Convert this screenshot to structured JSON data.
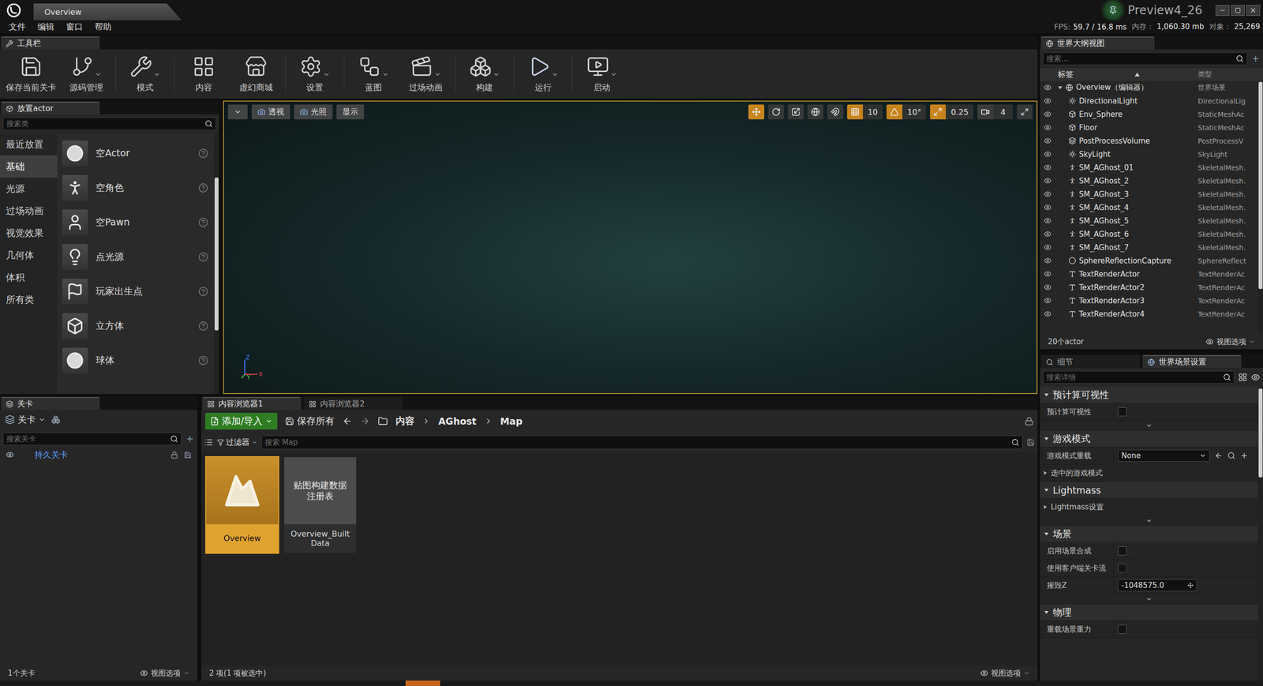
{
  "window": {
    "title": "Overview",
    "project": "Preview4_26"
  },
  "menu": [
    {
      "label": "文件"
    },
    {
      "label": "编辑"
    },
    {
      "label": "窗口"
    },
    {
      "label": "帮助"
    }
  ],
  "stats": [
    {
      "label": "FPS:",
      "value": "59.7 / 16.8 ms"
    },
    {
      "label": "内存：",
      "value": "1,060.30 mb"
    },
    {
      "label": "对象：",
      "value": "25,269"
    }
  ],
  "toolbar": {
    "title": "工具栏",
    "buttons": [
      {
        "label": "保存当前关卡",
        "dropdown": false
      },
      {
        "label": "源码管理",
        "dropdown": true
      },
      {
        "label": "模式",
        "dropdown": true
      },
      {
        "label": "内容",
        "dropdown": false
      },
      {
        "label": "虚幻商城",
        "dropdown": false
      },
      {
        "label": "设置",
        "dropdown": true
      },
      {
        "label": "蓝图",
        "dropdown": true
      },
      {
        "label": "过场动画",
        "dropdown": true
      },
      {
        "label": "构建",
        "dropdown": true
      },
      {
        "label": "运行",
        "dropdown": true
      },
      {
        "label": "启动",
        "dropdown": true
      }
    ]
  },
  "place_actor": {
    "title": "放置actor",
    "search": {
      "placeholder": "搜索类"
    },
    "categories": [
      {
        "label": "最近放置",
        "selected": false
      },
      {
        "label": "基础",
        "selected": true
      },
      {
        "label": "光源",
        "selected": false
      },
      {
        "label": "过场动画",
        "selected": false
      },
      {
        "label": "视觉效果",
        "selected": false
      },
      {
        "label": "几何体",
        "selected": false
      },
      {
        "label": "体积",
        "selected": false
      },
      {
        "label": "所有类",
        "selected": false
      }
    ],
    "items": [
      {
        "label": "空Actor"
      },
      {
        "label": "空角色"
      },
      {
        "label": "空Pawn"
      },
      {
        "label": "点光源"
      },
      {
        "label": "玩家出生点"
      },
      {
        "label": "立方体"
      },
      {
        "label": "球体"
      }
    ]
  },
  "viewport": {
    "view_buttons": [
      {
        "label": "透视"
      },
      {
        "label": "光照"
      },
      {
        "label": "显示"
      }
    ],
    "transform_tools": [
      {
        "selected": true
      },
      {
        "selected": false
      },
      {
        "selected": false
      }
    ],
    "snaps": [
      {
        "value": "10",
        "on": true
      },
      {
        "value": "10°",
        "on": true
      },
      {
        "value": "0.25",
        "on": true
      },
      {
        "value": "4",
        "on": false
      }
    ],
    "axes": [
      "Z",
      "Y",
      "X"
    ]
  },
  "levels": {
    "title": "关卡",
    "menu": "关卡",
    "search": {
      "placeholder": "搜索关卡"
    },
    "items": [
      {
        "label": "持久关卡",
        "visible": true
      }
    ],
    "count": "1个关卡",
    "view_options": "视图选项"
  },
  "content_browser": {
    "tabs": [
      {
        "label": "内容浏览器1",
        "selected": true
      },
      {
        "label": "内容浏览器2",
        "selected": false
      }
    ],
    "add_button": "添加/导入",
    "save_all": "保存所有",
    "breadcrumbs": [
      "内容",
      "AGhost",
      "Map"
    ],
    "filter": "过滤器",
    "search": {
      "placeholder": "搜索 Map"
    },
    "assets": [
      {
        "name": "Overview",
        "kind": "level",
        "thumbnail_text": "",
        "selected": true
      },
      {
        "name": "Overview_Built Data",
        "kind": "data",
        "thumbnail_text": "贴图构建数据注册表",
        "selected": false
      }
    ],
    "status": "2 项(1 项被选中)",
    "view_options": "视图选项"
  },
  "outliner": {
    "title": "世界大纲视图",
    "search": {
      "placeholder": "搜索..."
    },
    "columns": [
      "标签",
      "类型"
    ],
    "rows": [
      {
        "label": "Overview（编辑器）",
        "type": "世界场景",
        "kind": "world",
        "depth": 0,
        "expanded": true
      },
      {
        "label": "DirectionalLight",
        "type": "DirectionalLig",
        "kind": "light",
        "depth": 1
      },
      {
        "label": "Env_Sphere",
        "type": "StaticMeshAc",
        "kind": "mesh",
        "depth": 1
      },
      {
        "label": "Floor",
        "type": "StaticMeshAc",
        "kind": "mesh",
        "depth": 1
      },
      {
        "label": "PostProcessVolume",
        "type": "PostProcessV",
        "kind": "volume",
        "depth": 1
      },
      {
        "label": "SkyLight",
        "type": "SkyLight",
        "kind": "light",
        "depth": 1
      },
      {
        "label": "SM_AGhost_01",
        "type": "SkeletalMesh.",
        "kind": "skeletal",
        "depth": 1
      },
      {
        "label": "SM_AGhost_2",
        "type": "SkeletalMesh.",
        "kind": "skeletal",
        "depth": 1
      },
      {
        "label": "SM_AGhost_3",
        "type": "SkeletalMesh.",
        "kind": "skeletal",
        "depth": 1
      },
      {
        "label": "SM_AGhost_4",
        "type": "SkeletalMesh.",
        "kind": "skeletal",
        "depth": 1
      },
      {
        "label": "SM_AGhost_5",
        "type": "SkeletalMesh.",
        "kind": "skeletal",
        "depth": 1
      },
      {
        "label": "SM_AGhost_6",
        "type": "SkeletalMesh.",
        "kind": "skeletal",
        "depth": 1
      },
      {
        "label": "SM_AGhost_7",
        "type": "SkeletalMesh.",
        "kind": "skeletal",
        "depth": 1
      },
      {
        "label": "SphereReflectionCapture",
        "type": "SphereReflect",
        "kind": "capture",
        "depth": 1
      },
      {
        "label": "TextRenderActor",
        "type": "TextRenderAc",
        "kind": "text",
        "depth": 1
      },
      {
        "label": "TextRenderActor2",
        "type": "TextRenderAc",
        "kind": "text",
        "depth": 1
      },
      {
        "label": "TextRenderActor3",
        "type": "TextRenderAc",
        "kind": "text",
        "depth": 1
      },
      {
        "label": "TextRenderActor4",
        "type": "TextRenderAc",
        "kind": "text",
        "depth": 1
      }
    ],
    "count": "20个actor",
    "view_options": "视图选项"
  },
  "details": {
    "tabs": [
      {
        "label": "细节",
        "selected": false
      },
      {
        "label": "世界场景设置",
        "selected": true
      }
    ],
    "search": {
      "placeholder": "搜索详情"
    },
    "sections": [
      {
        "title": "预计算可视性",
        "expanded": true,
        "advanced": true,
        "rows": [
          {
            "label": "预计算可视性",
            "kind": "checkbox",
            "checked": false
          }
        ]
      },
      {
        "title": "游戏模式",
        "expanded": true,
        "advanced": false,
        "rows": [
          {
            "label": "游戏模式重载",
            "kind": "dropdown",
            "value": "None"
          },
          {
            "label": "选中的游戏模式",
            "kind": "group",
            "expanded": false
          }
        ]
      },
      {
        "title": "Lightmass",
        "expanded": true,
        "advanced": true,
        "rows": [
          {
            "label": "Lightmass设置",
            "kind": "group",
            "expanded": false
          }
        ]
      },
      {
        "title": "场景",
        "expanded": true,
        "advanced": true,
        "rows": [
          {
            "label": "启用场景合成",
            "kind": "checkbox",
            "checked": false
          },
          {
            "label": "使用客户端关卡流",
            "kind": "checkbox",
            "checked": false
          },
          {
            "label": "摧毁Z",
            "kind": "number",
            "value": "-1048575.0"
          }
        ]
      },
      {
        "title": "物理",
        "expanded": true,
        "advanced": false,
        "rows": [
          {
            "label": "重载场景重力",
            "kind": "checkbox",
            "checked": false
          }
        ]
      }
    ]
  }
}
